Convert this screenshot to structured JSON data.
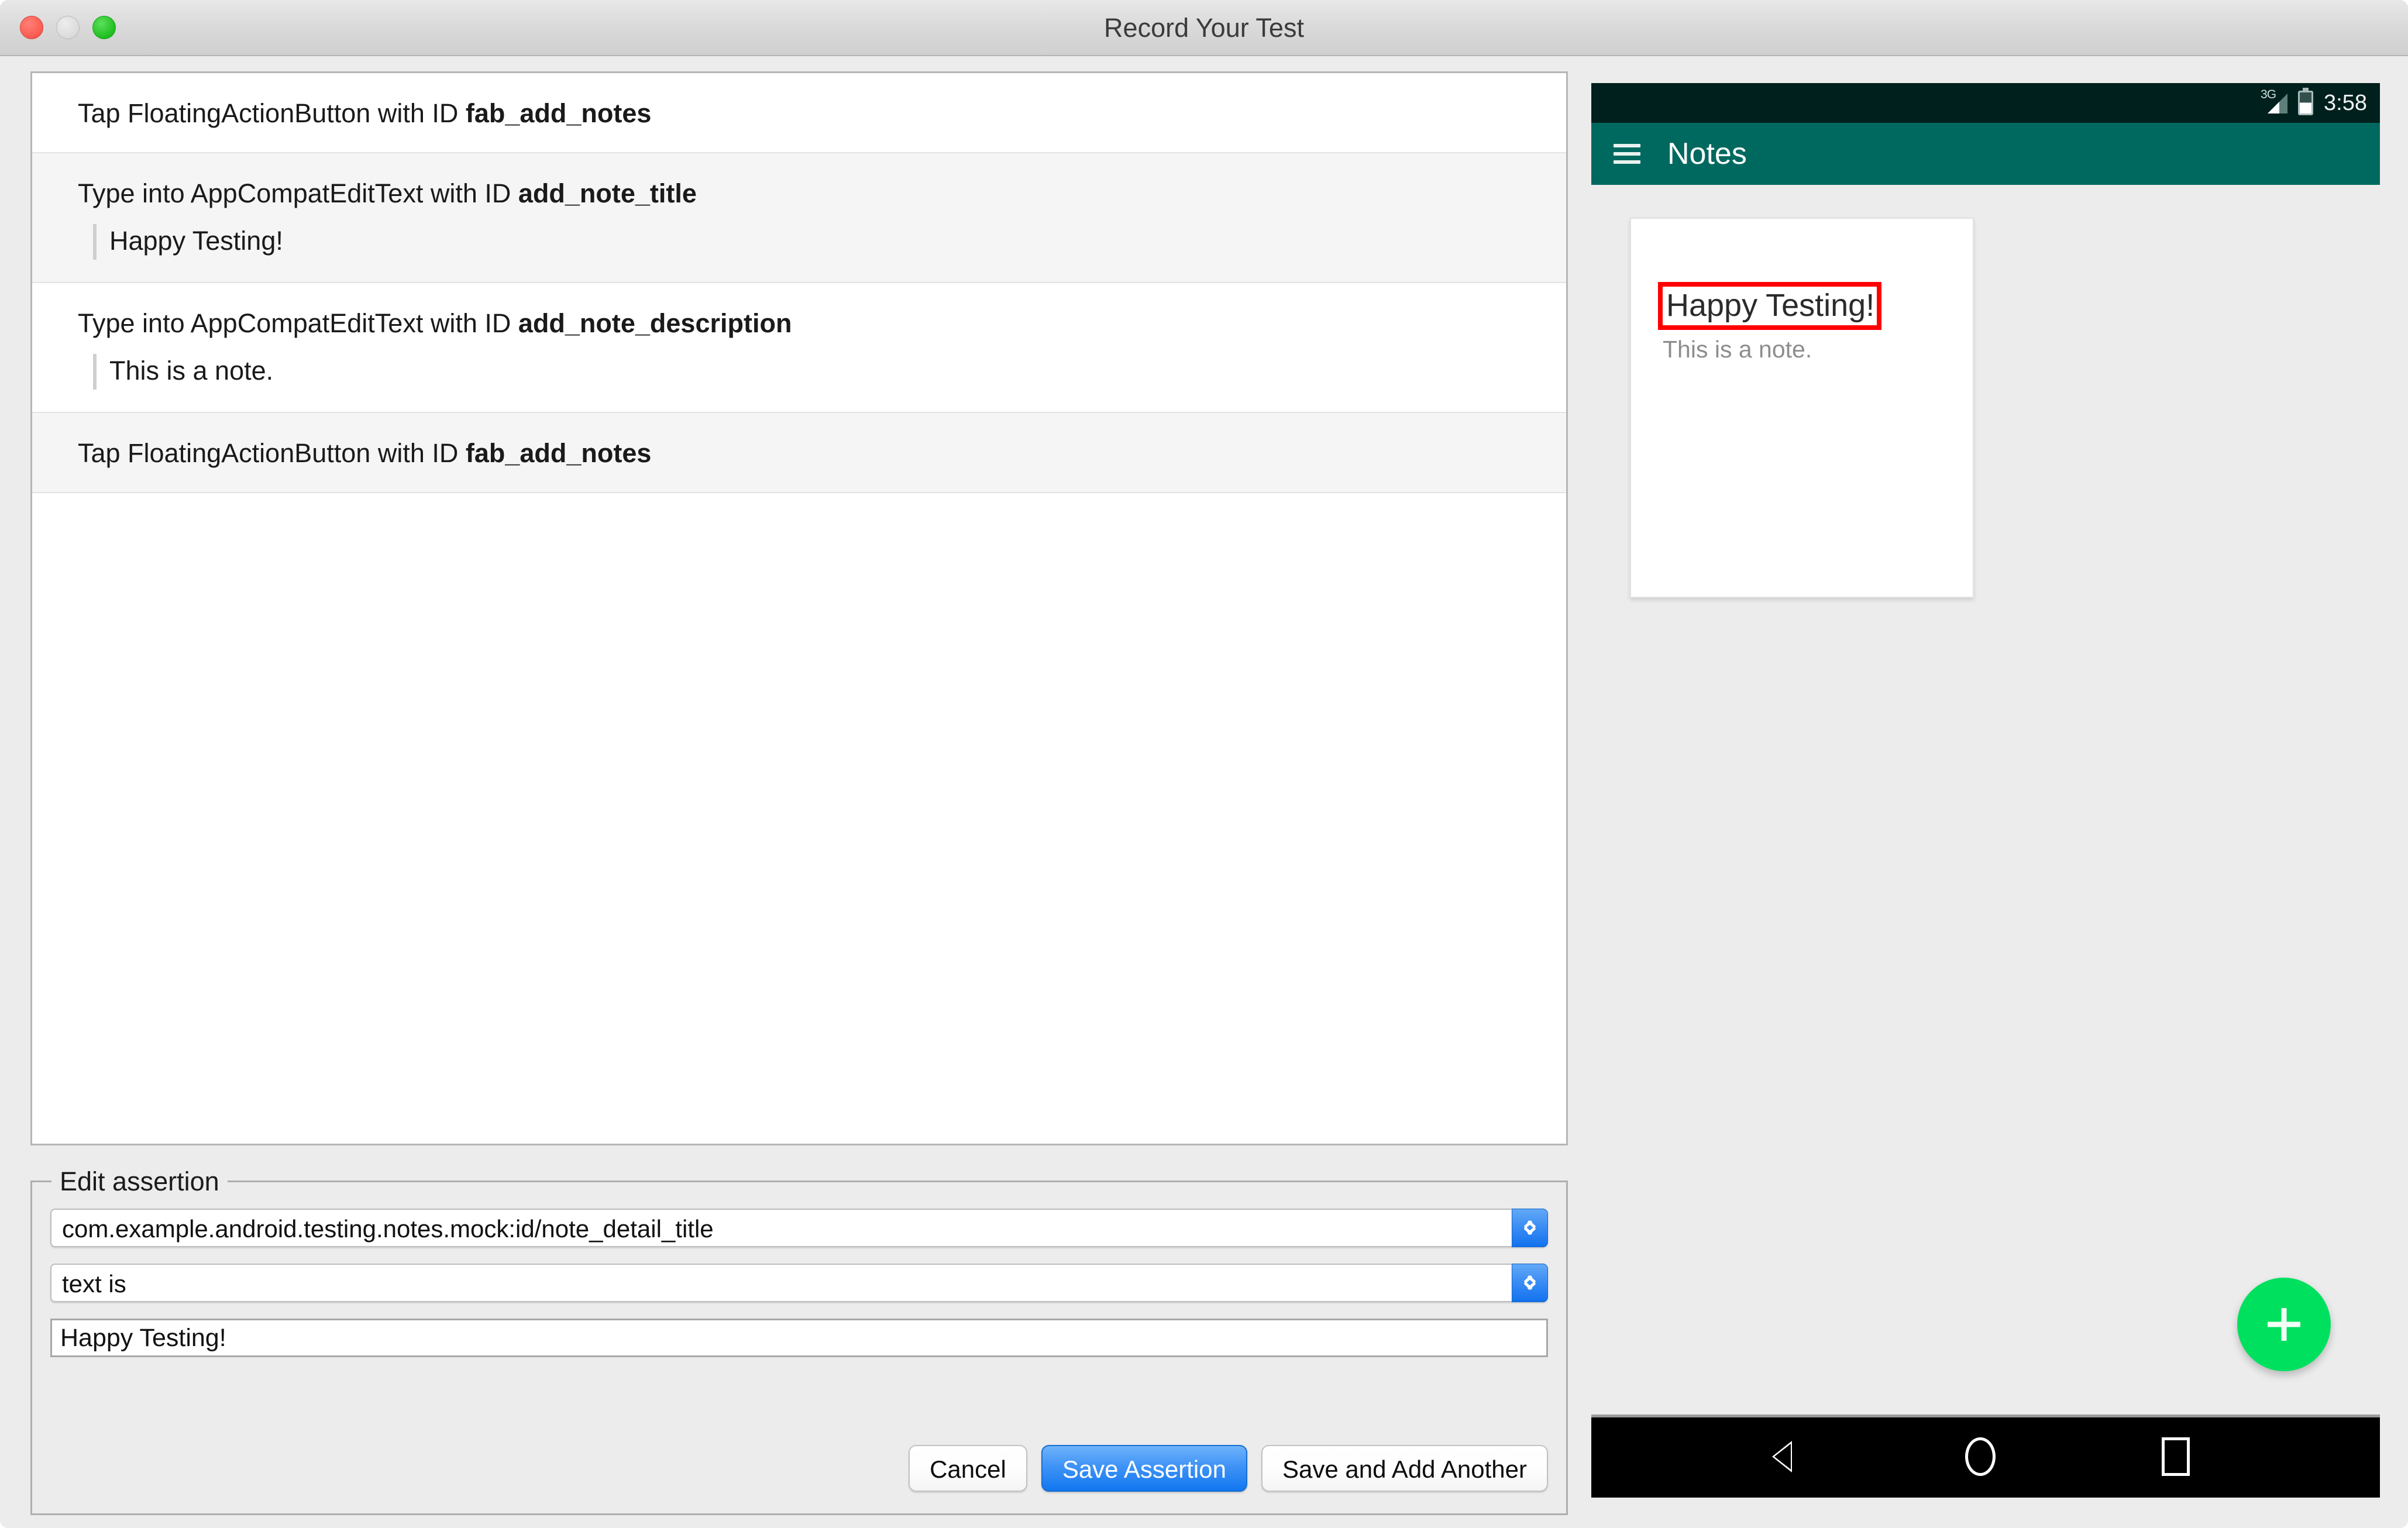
{
  "window": {
    "title": "Record Your Test",
    "traffic_lights": [
      "close-button",
      "minimize-button",
      "maximize-button"
    ]
  },
  "action_list": [
    {
      "prefix": "Tap FloatingActionButton with ID ",
      "id": "fab_add_notes",
      "sub": null
    },
    {
      "prefix": "Type into AppCompatEditText with ID ",
      "id": "add_note_title",
      "sub": "Happy Testing!"
    },
    {
      "prefix": "Type into AppCompatEditText with ID ",
      "id": "add_note_description",
      "sub": "This is a note."
    },
    {
      "prefix": "Tap FloatingActionButton with ID ",
      "id": "fab_add_notes",
      "sub": null
    }
  ],
  "edit_assertion": {
    "legend": "Edit assertion",
    "target_selector": {
      "value": "com.example.android.testing.notes.mock:id/note_detail_title"
    },
    "matcher_selector": {
      "value": "text is"
    },
    "assertion_value": {
      "value": "Happy Testing!"
    },
    "buttons": {
      "cancel": "Cancel",
      "save_assertion": "Save Assertion",
      "save_and_add_another": "Save and Add Another"
    }
  },
  "device": {
    "status_bar": {
      "network": "3G",
      "clock": "3:58",
      "background": "#00201d"
    },
    "toolbar": {
      "title": "Notes",
      "background": "#00695f"
    },
    "note_card": {
      "title": "Happy Testing!",
      "description": "This is a note.",
      "highlight_color": "#ff0000"
    },
    "fab": {
      "label": "+",
      "color": "#00e05f"
    },
    "nav_bar": {
      "back": "back-button",
      "home": "home-button",
      "recents": "recents-button"
    }
  },
  "colors": {
    "accent_blue": "#1277f0",
    "teal": "#00695f",
    "green": "#00e05f",
    "red_highlight": "#ff0000"
  }
}
